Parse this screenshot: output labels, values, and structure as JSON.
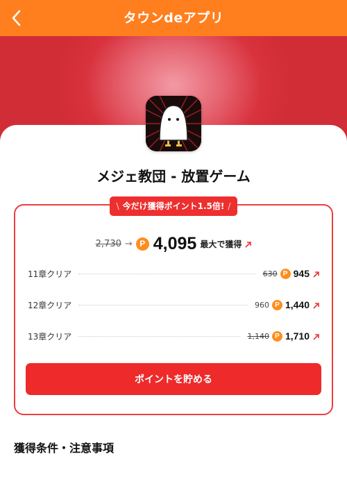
{
  "header": {
    "title": "タウンdeアプリ",
    "back_icon": "chevron-left-icon"
  },
  "colors": {
    "header": "#ff7f1e",
    "hero": "#d8323d",
    "accent_red": "#ee2f2f",
    "coin": "#ff8d1e"
  },
  "app": {
    "title": "メジェ教団 - 放置ゲーム",
    "icon": "ghost-app-icon"
  },
  "promo": {
    "slash_left": "\\",
    "text": "今だけ獲得ポイント1.5倍!",
    "slash_right": "/"
  },
  "total": {
    "old": "2,730",
    "arrow": "→",
    "coin_symbol": "P",
    "new": "4,095",
    "note": "最大で獲得"
  },
  "rewards": [
    {
      "label": "11章クリア",
      "old": "630",
      "new": "945"
    },
    {
      "label": "12章クリア",
      "old": "960",
      "new": "1,440"
    },
    {
      "label": "13章クリア",
      "old": "1,140",
      "new": "1,710"
    }
  ],
  "cta": {
    "label": "ポイントを貯める"
  },
  "conditions": {
    "title": "獲得条件・注意事項"
  }
}
